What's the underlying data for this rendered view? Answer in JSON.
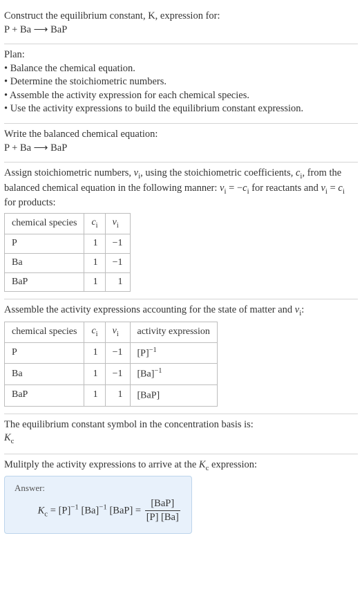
{
  "intro": {
    "line1": "Construct the equilibrium constant, K, expression for:",
    "equation": "P + Ba ⟶ BaP"
  },
  "plan": {
    "title": "Plan:",
    "items": [
      "• Balance the chemical equation.",
      "• Determine the stoichiometric numbers.",
      "• Assemble the activity expression for each chemical species.",
      "• Use the activity expressions to build the equilibrium constant expression."
    ]
  },
  "balanced": {
    "title": "Write the balanced chemical equation:",
    "equation": "P + Ba ⟶ BaP"
  },
  "stoich": {
    "text_a": "Assign stoichiometric numbers, ",
    "sym_nu": "ν",
    "sub_i": "i",
    "text_b": ", using the stoichiometric coefficients, ",
    "sym_c": "c",
    "text_c": ", from the balanced chemical equation in the following manner: ",
    "rule1_a": "ν",
    "rule1_b": " = −",
    "rule1_c": "c",
    "text_d": " for reactants and ",
    "rule2_a": "ν",
    "rule2_b": " = ",
    "rule2_c": "c",
    "text_e": " for products:",
    "headers": {
      "h1": "chemical species",
      "h2": "c",
      "h2sub": "i",
      "h3": "ν",
      "h3sub": "i"
    },
    "rows": [
      {
        "species": "P",
        "c": "1",
        "nu": "−1"
      },
      {
        "species": "Ba",
        "c": "1",
        "nu": "−1"
      },
      {
        "species": "BaP",
        "c": "1",
        "nu": "1"
      }
    ]
  },
  "activity": {
    "text_a": "Assemble the activity expressions accounting for the state of matter and ",
    "sym_nu": "ν",
    "sub_i": "i",
    "text_b": ":",
    "headers": {
      "h1": "chemical species",
      "h2": "c",
      "h2sub": "i",
      "h3": "ν",
      "h3sub": "i",
      "h4": "activity expression"
    },
    "rows": [
      {
        "species": "P",
        "c": "1",
        "nu": "−1",
        "expr": "[P]",
        "sup": "−1"
      },
      {
        "species": "Ba",
        "c": "1",
        "nu": "−1",
        "expr": "[Ba]",
        "sup": "−1"
      },
      {
        "species": "BaP",
        "c": "1",
        "nu": "1",
        "expr": "[BaP]",
        "sup": ""
      }
    ]
  },
  "symbol": {
    "line1": "The equilibrium constant symbol in the concentration basis is:",
    "K": "K",
    "sub": "c"
  },
  "multiply": {
    "text_a": "Mulitply the activity expressions to arrive at the ",
    "K": "K",
    "sub": "c",
    "text_b": " expression:"
  },
  "answer": {
    "label": "Answer:",
    "K": "K",
    "sub": "c",
    "eq": " = ",
    "t1": "[P]",
    "s1": "−1",
    "t2": " [Ba]",
    "s2": "−1",
    "t3": " [BaP] = ",
    "num": "[BaP]",
    "den": "[P] [Ba]"
  }
}
